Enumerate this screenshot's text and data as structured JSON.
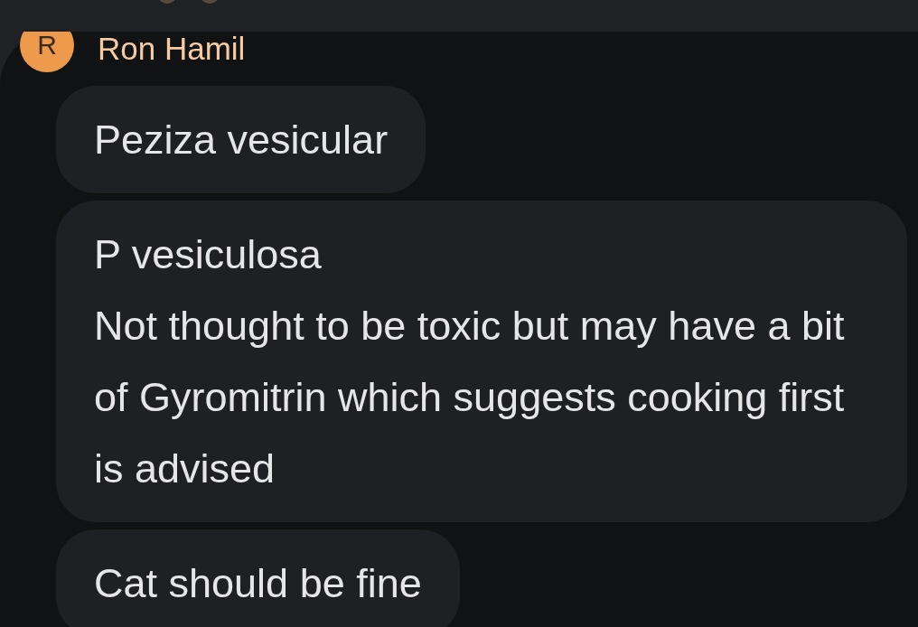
{
  "sender": {
    "initial": "R",
    "name": "Ron Hamil",
    "color": "#ee9a4c"
  },
  "messages": [
    {
      "text": "Peziza vesicular"
    },
    {
      "text": "P vesiculosa\nNot thought to be toxic but may have a bit of Gyromitrin which suggests cooking first is advised"
    },
    {
      "text": "Cat should be fine"
    }
  ]
}
